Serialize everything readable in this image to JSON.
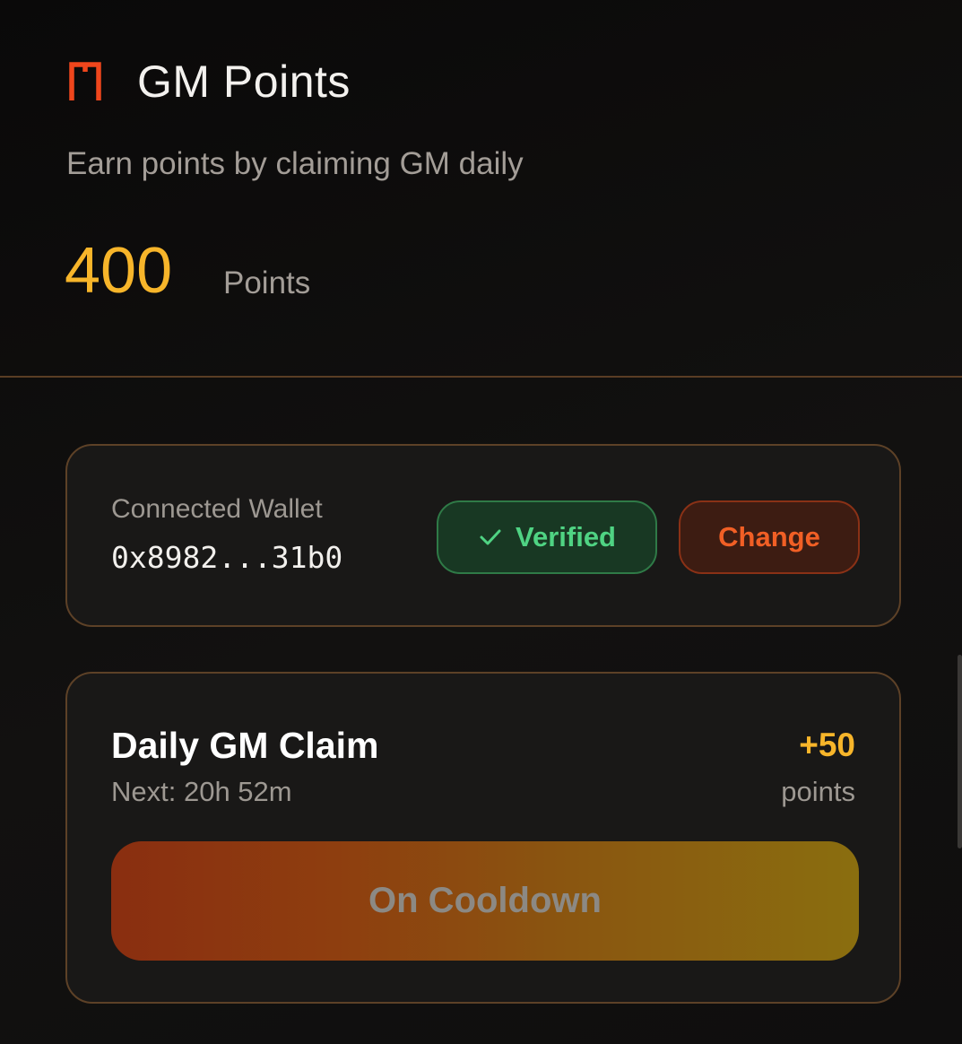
{
  "header": {
    "logo_icon": "gm-logo-icon",
    "title": "GM Points",
    "subtitle": "Earn points by claiming GM daily",
    "points_value": "400",
    "points_unit": "Points"
  },
  "wallet": {
    "label": "Connected Wallet",
    "address": "0x8982...31b0",
    "verified_label": "Verified",
    "verified_icon": "check-icon",
    "change_label": "Change"
  },
  "claim": {
    "title": "Daily GM Claim",
    "next_text": "Next: 20h 52m",
    "reward_amount": "+50",
    "reward_unit": "points",
    "button_label": "On Cooldown"
  },
  "colors": {
    "accent_gold": "#f7b52a",
    "accent_orange": "#f15f25",
    "success_green": "#4fd383",
    "border_brown": "#5d4127",
    "background": "#0b0a0a"
  }
}
